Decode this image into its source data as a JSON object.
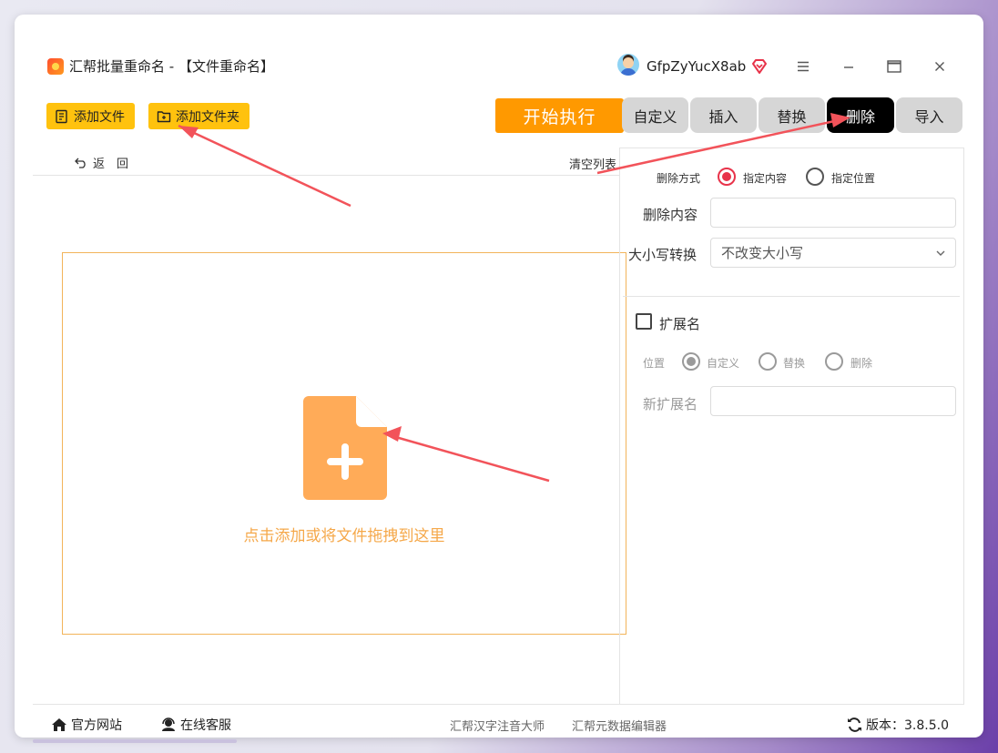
{
  "window": {
    "title": "汇帮批量重命名 - 【文件重命名】",
    "username": "GfpZyYucX8ab",
    "controls": {
      "menu": "≡",
      "minimize": "—",
      "maximize": "▭",
      "close": "✕"
    }
  },
  "toolbar": {
    "add_file": "添加文件",
    "add_folder": "添加文件夹",
    "start": "开始执行"
  },
  "tabs": [
    {
      "label": "自定义",
      "active": false
    },
    {
      "label": "插入",
      "active": false
    },
    {
      "label": "替换",
      "active": false
    },
    {
      "label": "删除",
      "active": true
    },
    {
      "label": "导入",
      "active": false
    }
  ],
  "file_list": {
    "back": "返　回",
    "clear": "清空列表",
    "drop_hint": "点击添加或将文件拖拽到这里"
  },
  "delete_panel": {
    "mode_label": "删除方式",
    "mode_options": [
      {
        "label": "指定内容",
        "selected": true
      },
      {
        "label": "指定位置",
        "selected": false
      }
    ],
    "content_label": "删除内容",
    "content_value": "",
    "case_label": "大小写转换",
    "case_value": "不改变大小写"
  },
  "extension": {
    "checkbox_label": "扩展名",
    "checked": false,
    "position_label": "位置",
    "position_options": [
      {
        "label": "自定义",
        "selected": true
      },
      {
        "label": "替换",
        "selected": false
      },
      {
        "label": "删除",
        "selected": false
      }
    ],
    "new_ext_label": "新扩展名",
    "new_ext_value": ""
  },
  "footer": {
    "official_site": "官方网站",
    "online_service": "在线客服",
    "link1": "汇帮汉字注音大师",
    "link2": "汇帮元数据编辑器",
    "version": "版本：3.8.5.0"
  },
  "colors": {
    "accent_orange": "#ff9900",
    "tool_yellow": "#ffc20e",
    "active_tab": "#000000",
    "radio_selected": "#e8334a",
    "drop_border": "#f2b45a",
    "arrow_red": "#f2535a"
  }
}
